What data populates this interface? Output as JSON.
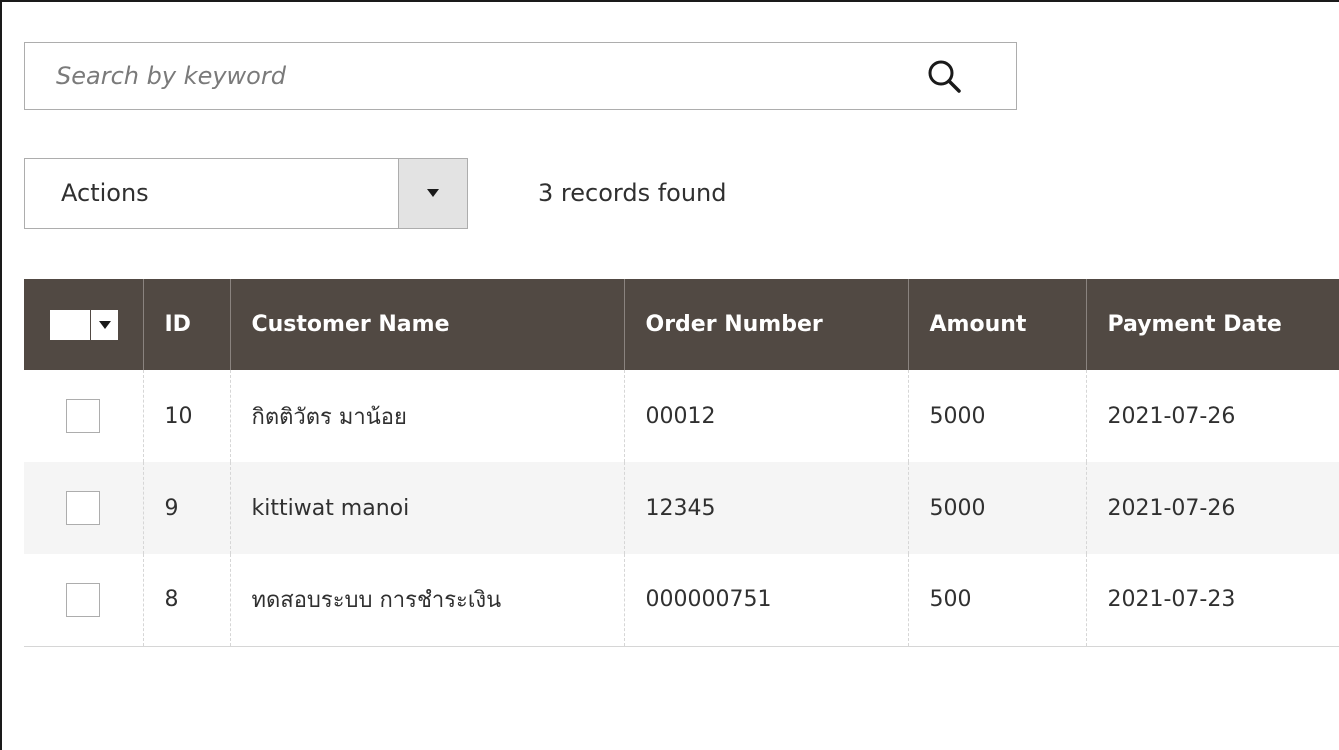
{
  "search": {
    "placeholder": "Search by keyword",
    "value": ""
  },
  "toolbar": {
    "actions_label": "Actions",
    "records_found": "3 records found"
  },
  "grid": {
    "columns": [
      "ID",
      "Customer Name",
      "Order Number",
      "Amount",
      "Payment Date"
    ],
    "rows": [
      {
        "id": "10",
        "customer_name": "กิตติวัตร มาน้อย",
        "order_number": "00012",
        "amount": "5000",
        "payment_date": "2021-07-26",
        "checked": false
      },
      {
        "id": "9",
        "customer_name": "kittiwat manoi",
        "order_number": "12345",
        "amount": "5000",
        "payment_date": "2021-07-26",
        "checked": false
      },
      {
        "id": "8",
        "customer_name": "ทดสอบระบบ การชำระเงิน",
        "order_number": "000000751",
        "amount": "500",
        "payment_date": "2021-07-23",
        "checked": false
      }
    ]
  },
  "colors": {
    "header_bg": "#514943",
    "header_text": "#ffffff",
    "alt_row_bg": "#f5f5f5",
    "border": "#adadad"
  },
  "icons": {
    "search": "search-icon",
    "dropdown": "caret-down-icon"
  }
}
